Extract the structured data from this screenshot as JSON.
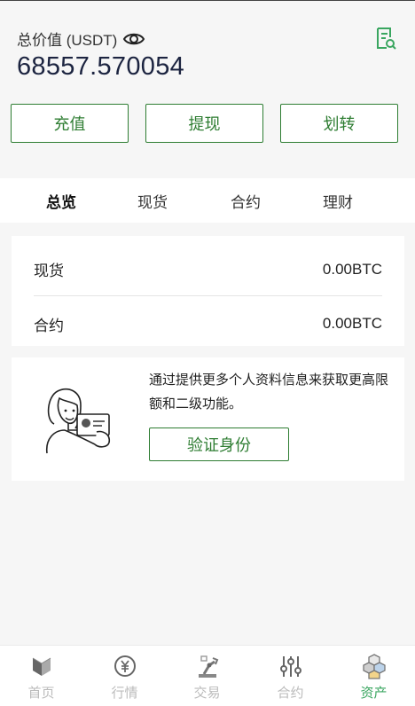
{
  "header": {
    "total_label": "总价值 (USDT)",
    "total_value": "68557.570054"
  },
  "actions": {
    "recharge": "充值",
    "withdraw": "提现",
    "transfer": "划转"
  },
  "tabs": [
    {
      "label": "总览",
      "active": true
    },
    {
      "label": "现货",
      "active": false
    },
    {
      "label": "合约",
      "active": false
    },
    {
      "label": "理财",
      "active": false
    }
  ],
  "balances": [
    {
      "label": "现货",
      "value": "0.00BTC"
    },
    {
      "label": "合约",
      "value": "0.00BTC"
    }
  ],
  "verify": {
    "text": "通过提供更多个人资料信息来获取更高限额和二级功能。",
    "button": "验证身份"
  },
  "nav": [
    {
      "label": "首页",
      "icon": "home-icon",
      "active": false
    },
    {
      "label": "行情",
      "icon": "market-icon",
      "active": false
    },
    {
      "label": "交易",
      "icon": "trade-icon",
      "active": false
    },
    {
      "label": "合约",
      "icon": "contract-icon",
      "active": false
    },
    {
      "label": "资产",
      "icon": "assets-icon",
      "active": true
    }
  ],
  "colors": {
    "accent": "#2e7d32",
    "nav_active": "#3aa660",
    "background": "#f6f6f6"
  }
}
